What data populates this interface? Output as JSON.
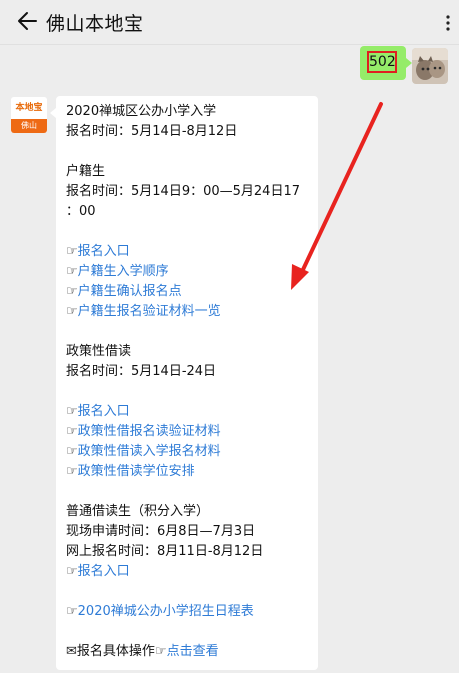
{
  "header": {
    "title": "佛山本地宝",
    "back_icon": "back-arrow-icon",
    "more_icon": "more-vertical-icon"
  },
  "outgoing": {
    "text": "502",
    "bubble_color": "#95ec69",
    "highlight_color": "#e02020"
  },
  "account": {
    "logo_top": "本地宝",
    "logo_bottom": "佛山"
  },
  "message": {
    "lines": [
      {
        "text": "2020禅城区公办小学入学"
      },
      {
        "text": "报名时间：5月14日-8月12日"
      },
      {
        "text": ""
      },
      {
        "text": "户籍生"
      },
      {
        "text": "报名时间：5月14日9：00—5月24日17"
      },
      {
        "text": "：00"
      },
      {
        "text": ""
      },
      {
        "hand": "☞",
        "link": "报名入口"
      },
      {
        "hand": "☞",
        "link": "户籍生入学顺序"
      },
      {
        "hand": "☞",
        "link": "户籍生确认报名点"
      },
      {
        "hand": "☞",
        "link": "户籍生报名验证材料一览"
      },
      {
        "text": ""
      },
      {
        "text": "政策性借读"
      },
      {
        "text": "报名时间：5月14日-24日"
      },
      {
        "text": ""
      },
      {
        "hand": "☞",
        "link": "报名入口"
      },
      {
        "hand": "☞",
        "link": "政策性借报名读验证材料"
      },
      {
        "hand": "☞",
        "link": "政策性借读入学报名材料"
      },
      {
        "hand": "☞",
        "link": "政策性借读学位安排"
      },
      {
        "text": ""
      },
      {
        "text": "普通借读生（积分入学）"
      },
      {
        "text": "现场申请时间：6月8日—7月3日"
      },
      {
        "text": "网上报名时间：8月11日-8月12日"
      },
      {
        "hand": "☞",
        "link": "报名入口"
      },
      {
        "text": ""
      },
      {
        "hand": "☞",
        "link": "2020禅城公办小学招生日程表"
      },
      {
        "text": ""
      },
      {
        "hand": "✉",
        "text": "报名具体操作",
        "hand2": "☞",
        "link": "点击查看"
      }
    ],
    "link_color": "#2e7bd6"
  },
  "annotation": {
    "arrow_color": "#e8231f"
  }
}
